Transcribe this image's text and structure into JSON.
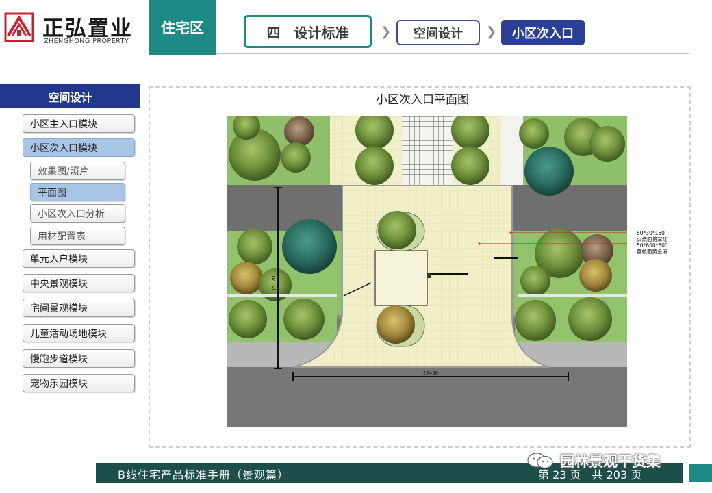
{
  "header": {
    "logo_cn": "正弘置业",
    "logo_en": "ZHENGHONG PROPERTY",
    "zone": "住宅区",
    "breadcrumbs": [
      "四　设计标准",
      "空间设计",
      "小区次入口"
    ],
    "accent": "#1e8a86",
    "nav_blue": "#2c3e97"
  },
  "sidebar": {
    "heading": "空间设计",
    "items": [
      {
        "label": "小区主入口模块",
        "level": 1,
        "selected": false
      },
      {
        "label": "小区次入口模块",
        "level": 1,
        "selected": true
      },
      {
        "label": "效果图/照片",
        "level": 2,
        "selected": false
      },
      {
        "label": "平面图",
        "level": 2,
        "selected": true
      },
      {
        "label": "小区次入口分析",
        "level": 2,
        "selected": false
      },
      {
        "label": "用材配置表",
        "level": 2,
        "selected": false
      },
      {
        "label": "单元入户模块",
        "level": 1,
        "selected": false
      },
      {
        "label": "中央景观模块",
        "level": 1,
        "selected": false
      },
      {
        "label": "宅间景观模块",
        "level": 1,
        "selected": false
      },
      {
        "label": "儿童活动场地模块",
        "level": 1,
        "selected": false
      },
      {
        "label": "慢跑步道模块",
        "level": 1,
        "selected": false
      },
      {
        "label": "宠物乐园模块",
        "level": 1,
        "selected": false
      }
    ]
  },
  "main": {
    "title": "小区次入口平面图",
    "plan": {
      "dim_width": "27450",
      "dim_height": "15120",
      "annotations": [
        "50*30*150",
        "火烧面将军红",
        "50*600*600",
        "荔枝面黄金麻"
      ]
    }
  },
  "footer": {
    "title": "B线住宅产品标准手册（景观篇）",
    "page": "第 23 页　共 203 页",
    "watermark": "园林景观干货集"
  }
}
